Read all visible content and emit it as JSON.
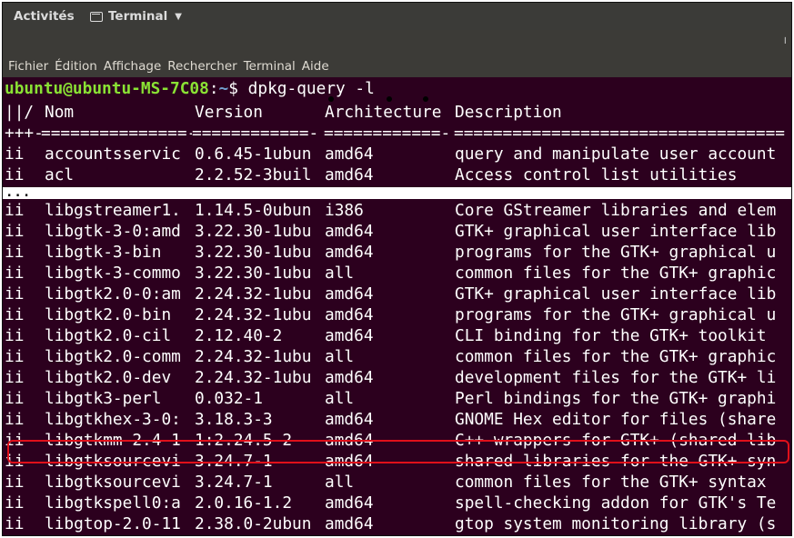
{
  "topbar": {
    "activities": "Activités",
    "app_name": "Terminal"
  },
  "menubar": [
    "Fichier",
    "Édition",
    "Affichage",
    "Rechercher",
    "Terminal",
    "Aide"
  ],
  "terminal": {
    "prompt_user": "ubuntu@ubuntu-MS-7C08",
    "prompt_sep": ":",
    "prompt_path": "~",
    "prompt_symbol": "$",
    "command": " dpkg-query -l",
    "header": {
      "c1": "||/",
      "c2": "Nom",
      "c3": "Version",
      "c4": "Architecture",
      "c5": "Description"
    },
    "rule": {
      "c1": "+++-",
      "c2": "===============-",
      "c3": "============-",
      "c4": "============-",
      "c5": "=================================="
    },
    "rows_top": [
      {
        "c1": "ii",
        "c2": "accountsservic",
        "c3": "0.6.45-1ubun",
        "c4": "amd64",
        "c5": "query and manipulate user account"
      },
      {
        "c1": "ii",
        "c2": "acl",
        "c3": "2.2.52-3buil",
        "c4": "amd64",
        "c5": "Access control list utilities"
      }
    ],
    "ellipsis": "...",
    "rows_bottom": [
      {
        "c1": "ii",
        "c2": "libgstreamer1.",
        "c3": "1.14.5-0ubun",
        "c4": "i386",
        "c5": "Core GStreamer libraries and elem"
      },
      {
        "c1": "ii",
        "c2": "libgtk-3-0:amd",
        "c3": "3.22.30-1ubu",
        "c4": "amd64",
        "c5": "GTK+ graphical user interface lib"
      },
      {
        "c1": "ii",
        "c2": "libgtk-3-bin",
        "c3": "3.22.30-1ubu",
        "c4": "amd64",
        "c5": "programs for the GTK+ graphical u"
      },
      {
        "c1": "ii",
        "c2": "libgtk-3-commo",
        "c3": "3.22.30-1ubu",
        "c4": "all",
        "c5": "common files for the GTK+ graphic"
      },
      {
        "c1": "ii",
        "c2": "libgtk2.0-0:am",
        "c3": "2.24.32-1ubu",
        "c4": "amd64",
        "c5": "GTK+ graphical user interface lib"
      },
      {
        "c1": "ii",
        "c2": "libgtk2.0-bin",
        "c3": "2.24.32-1ubu",
        "c4": "amd64",
        "c5": "programs for the GTK+ graphical u"
      },
      {
        "c1": "ii",
        "c2": "libgtk2.0-cil",
        "c3": "2.12.40-2",
        "c4": "amd64",
        "c5": "CLI binding for the GTK+ toolkit"
      },
      {
        "c1": "ii",
        "c2": "libgtk2.0-comm",
        "c3": "2.24.32-1ubu",
        "c4": "all",
        "c5": "common files for the GTK+ graphic"
      },
      {
        "c1": "ii",
        "c2": "libgtk2.0-dev",
        "c3": "2.24.32-1ubu",
        "c4": "amd64",
        "c5": "development files for the GTK+ li"
      },
      {
        "c1": "ii",
        "c2": "libgtk3-perl",
        "c3": "0.032-1",
        "c4": "all",
        "c5": "Perl bindings for the GTK+ graphi"
      },
      {
        "c1": "ii",
        "c2": "libgtkhex-3-0:",
        "c3": "3.18.3-3",
        "c4": "amd64",
        "c5": "GNOME Hex editor for files (share"
      },
      {
        "c1": "ii",
        "c2": "libgtkmm-2.4-1",
        "c3": "1:2.24.5-2",
        "c4": "amd64",
        "c5": "C++ wrappers for GTK+ (shared lib"
      },
      {
        "c1": "ii",
        "c2": "libgtksourcevi",
        "c3": "3.24.7-1",
        "c4": "amd64",
        "c5": "shared libraries for the GTK+ syn"
      },
      {
        "c1": "ii",
        "c2": "libgtksourcevi",
        "c3": "3.24.7-1",
        "c4": "all",
        "c5": "common files for the GTK+ syntax"
      },
      {
        "c1": "ii",
        "c2": "libgtkspell0:a",
        "c3": "2.0.16-1.2",
        "c4": "amd64",
        "c5": "spell-checking addon for GTK's Te"
      },
      {
        "c1": "ii",
        "c2": "libgtop-2.0-11",
        "c3": "2.38.0-2ubun",
        "c4": "amd64",
        "c5": "gtop system monitoring library (s"
      }
    ]
  },
  "colors": {
    "terminal_bg": "#2c001e",
    "prompt_user": "#8ae234",
    "prompt_path": "#729fcf",
    "highlight": "#e0101a"
  }
}
